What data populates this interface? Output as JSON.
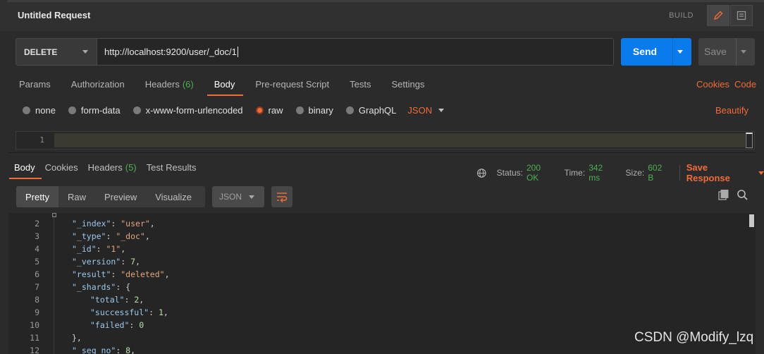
{
  "header": {
    "title": "Untitled Request",
    "build": "BUILD"
  },
  "request": {
    "method": "DELETE",
    "url": "http://localhost:9200/user/_doc/1",
    "send_label": "Send",
    "save_label": "Save"
  },
  "req_tabs": {
    "params": "Params",
    "authorization": "Authorization",
    "headers": "Headers",
    "headers_count": "(6)",
    "body": "Body",
    "prerequest": "Pre-request Script",
    "tests": "Tests",
    "settings": "Settings",
    "cookies": "Cookies",
    "code": "Code"
  },
  "body_options": {
    "none": "none",
    "form_data": "form-data",
    "urlencoded": "x-www-form-urlencoded",
    "raw": "raw",
    "binary": "binary",
    "graphql": "GraphQL",
    "format": "JSON",
    "beautify": "Beautify",
    "selected": "raw"
  },
  "editor": {
    "line1": "1"
  },
  "response": {
    "tabs": {
      "body": "Body",
      "cookies": "Cookies",
      "headers": "Headers",
      "headers_count": "(5)",
      "test_results": "Test Results"
    },
    "status_label": "Status:",
    "status_value": "200 OK",
    "time_label": "Time:",
    "time_value": "342 ms",
    "size_label": "Size:",
    "size_value": "602 B",
    "save_response": "Save Response",
    "views": {
      "pretty": "Pretty",
      "raw": "Raw",
      "preview": "Preview",
      "visualize": "Visualize"
    },
    "format": "JSON",
    "lines": [
      {
        "n": "2",
        "key": "\"_index\"",
        "val": "\"user\"",
        "type": "s",
        "indent": 0,
        "trail": ","
      },
      {
        "n": "3",
        "key": "\"_type\"",
        "val": "\"_doc\"",
        "type": "s",
        "indent": 0,
        "trail": ","
      },
      {
        "n": "4",
        "key": "\"_id\"",
        "val": "\"1\"",
        "type": "s",
        "indent": 0,
        "trail": ","
      },
      {
        "n": "5",
        "key": "\"_version\"",
        "val": "7",
        "type": "n",
        "indent": 0,
        "trail": ","
      },
      {
        "n": "6",
        "key": "\"result\"",
        "val": "\"deleted\"",
        "type": "s",
        "indent": 0,
        "trail": ","
      },
      {
        "n": "7",
        "key": "\"_shards\"",
        "val": "{",
        "type": "p",
        "indent": 0,
        "trail": ""
      },
      {
        "n": "8",
        "key": "\"total\"",
        "val": "2",
        "type": "n",
        "indent": 1,
        "trail": ","
      },
      {
        "n": "9",
        "key": "\"successful\"",
        "val": "1",
        "type": "n",
        "indent": 1,
        "trail": ","
      },
      {
        "n": "10",
        "key": "\"failed\"",
        "val": "0",
        "type": "n",
        "indent": 1,
        "trail": ""
      },
      {
        "n": "11",
        "key": "",
        "val": "},",
        "type": "p",
        "indent": 0,
        "trail": ""
      },
      {
        "n": "12",
        "key": "\"_seq_no\"",
        "val": "8",
        "type": "n",
        "indent": 0,
        "trail": ","
      }
    ]
  },
  "watermark": "CSDN @Modify_lzq",
  "colors": {
    "accent": "#f26b3a",
    "send": "#097bed",
    "ok": "#4caf50"
  }
}
